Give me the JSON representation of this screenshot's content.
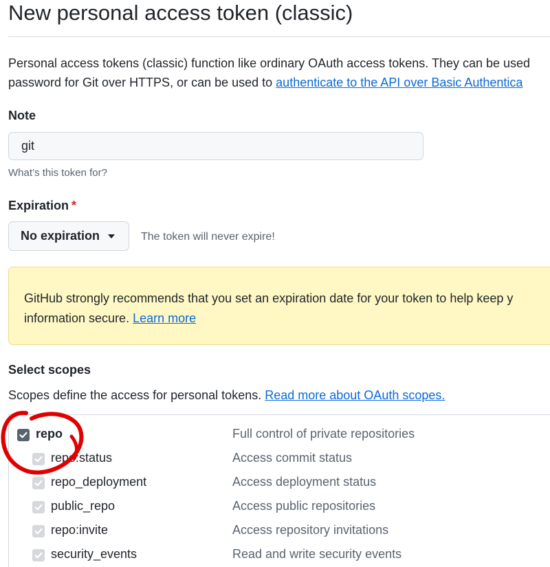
{
  "page": {
    "title": "New personal access token (classic)",
    "intro_line1": "Personal access tokens (classic) function like ordinary OAuth access tokens. They can be used",
    "intro_line2_prefix": "password for Git over HTTPS, or can be used to ",
    "intro_link": "authenticate to the API over Basic Authentica"
  },
  "note": {
    "label": "Note",
    "value": "git",
    "hint": "What’s this token for?"
  },
  "expiration": {
    "label": "Expiration",
    "required_mark": "*",
    "selected": "No expiration",
    "hint": "The token will never expire!"
  },
  "warning": {
    "line1": "GitHub strongly recommends that you set an expiration date for your token to help keep y",
    "line2_prefix": "information secure. ",
    "link": "Learn more"
  },
  "scopes": {
    "label": "Select scopes",
    "desc_prefix": "Scopes define the access for personal tokens. ",
    "desc_link": "Read more about OAuth scopes.",
    "items": [
      {
        "name": "repo",
        "desc": "Full control of private repositories",
        "checked": true,
        "level": "main"
      },
      {
        "name": "repo:status",
        "desc": "Access commit status",
        "checked": true,
        "level": "sub"
      },
      {
        "name": "repo_deployment",
        "desc": "Access deployment status",
        "checked": true,
        "level": "sub"
      },
      {
        "name": "public_repo",
        "desc": "Access public repositories",
        "checked": true,
        "level": "sub"
      },
      {
        "name": "repo:invite",
        "desc": "Access repository invitations",
        "checked": true,
        "level": "sub"
      },
      {
        "name": "security_events",
        "desc": "Read and write security events",
        "checked": true,
        "level": "sub"
      }
    ]
  },
  "colors": {
    "link": "#0969da",
    "warning_bg": "#fff8c5",
    "required": "#d1242f",
    "annotation": "#e00000"
  }
}
